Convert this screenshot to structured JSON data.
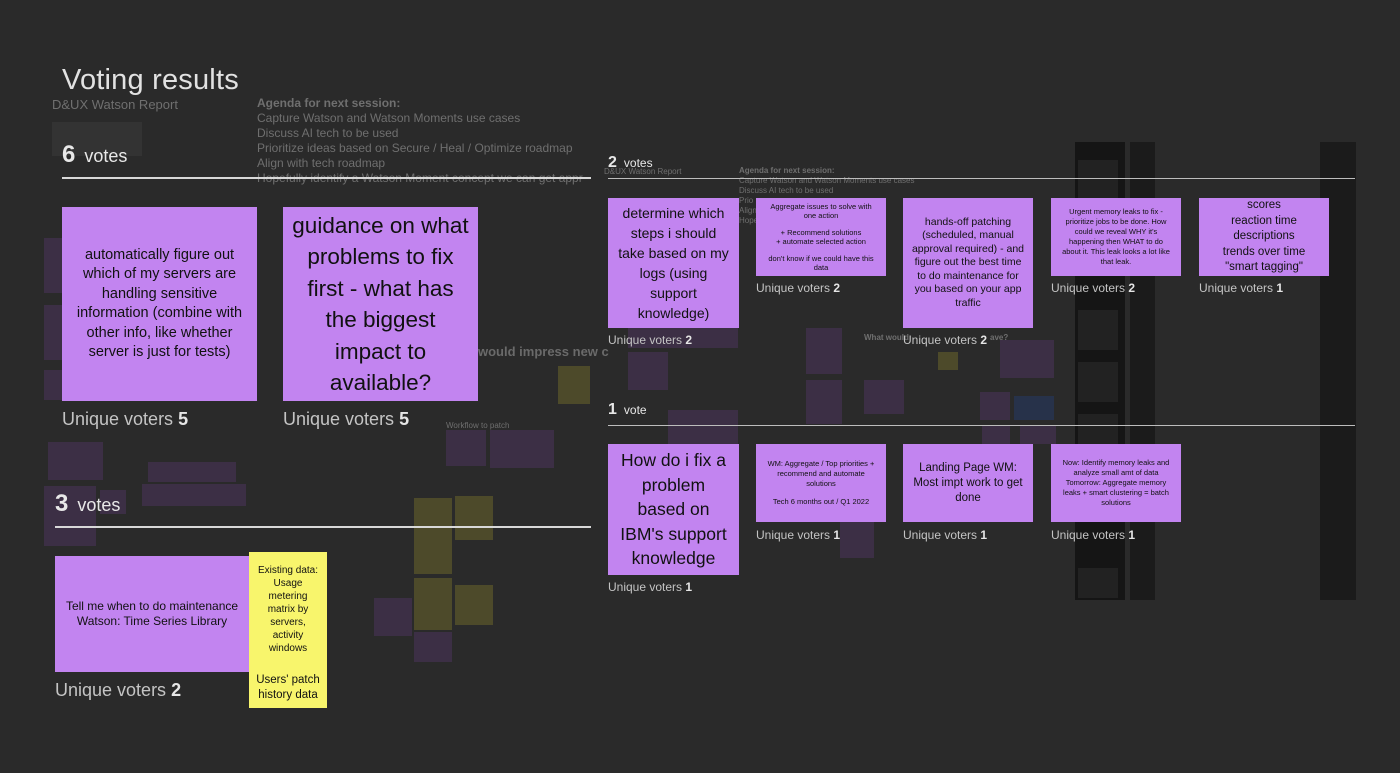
{
  "title": "Voting results",
  "voters_label": "Unique voters",
  "background": {
    "report_title": "D&UX Watson Report",
    "agenda_heading": "Agenda for next session:",
    "agenda_items": [
      "Capture Watson and Watson Moments use cases",
      "Discuss AI tech to be used",
      "Prioritize ideas based on Secure / Heal / Optimize roadmap",
      "Align with tech roadmap",
      "Hopefully identify a Watson Moment concept we can get appr"
    ],
    "small_report_title": "D&UX Watson Report",
    "small_agenda_heading": "Agenda for next session:",
    "small_agenda_items": [
      "Capture Watson and Watson Moments use cases",
      "Discuss AI tech to be used",
      "Prio",
      "Align",
      "Hope"
    ],
    "impress_text": "would impress new c",
    "impress_text_small": "What would",
    "impress_text_small2": "ave?",
    "workflow_label": "Workflow to patch"
  },
  "sections": {
    "six": {
      "count": "6",
      "label": "votes"
    },
    "three": {
      "count": "3",
      "label": "votes"
    },
    "two": {
      "count": "2",
      "label": "votes"
    },
    "one": {
      "count": "1",
      "label": "vote"
    }
  },
  "cards": {
    "c6a": {
      "text": "automatically figure out which of my servers are handling sensitive information (combine with other info, like whether server is just for tests)",
      "voters": "5"
    },
    "c6b": {
      "text": "guidance on what problems to fix first - what has the biggest impact to available?",
      "voters": "5"
    },
    "c3a": {
      "text": "Tell me when to do maintenance Watson: Time Series Library",
      "voters": "2"
    },
    "c3y": {
      "line1": "Existing data: Usage metering matrix by servers, activity windows",
      "line2": "Users' patch history data"
    },
    "c2a": {
      "text": "determine which steps i should take based on my logs (using support knowledge)",
      "voters": "2"
    },
    "c2b": {
      "line1": "Aggregate issues to solve with one action",
      "line2": "+ Recommend solutions\n+ automate selected action",
      "line3": "don't know if we could have this data",
      "voters": "2"
    },
    "c2c": {
      "text": "hands-off patching (scheduled, manual approval required) - and figure out the best time to do maintenance for you based on your app traffic",
      "voters": "2"
    },
    "c2d": {
      "text": "Urgent memory leaks to fix - prioritize jobs to be done. How could we reveal WHY it's happening then WHAT to do about it. This leak looks a lot like that leak.",
      "voters": "2"
    },
    "c2e": {
      "lines": [
        "scores",
        "reaction time",
        "descriptions",
        "trends over time",
        "\"smart tagging\""
      ],
      "voters": "1"
    },
    "c1a": {
      "text": "How do i fix a problem based on IBM's support knowledge",
      "voters": "1"
    },
    "c1b": {
      "line1": "WM: Aggregate / Top priorities + recommend and automate solutions",
      "line2": "Tech 6 months out / Q1 2022",
      "voters": "1"
    },
    "c1c": {
      "text": "Landing Page WM: Most impt work to get done",
      "voters": "1"
    },
    "c1d": {
      "text": "Now: Identify memory leaks and analyze small amt of data Tomorrow: Aggregate memory leaks + smart clustering = batch solutions",
      "voters": "1"
    }
  },
  "colors": {
    "background": "#2a2a2a",
    "card_purple": "#c284f0",
    "card_yellow": "#f8f56c",
    "text_light": "#e6e6e6",
    "rule": "#d8d8d8"
  }
}
